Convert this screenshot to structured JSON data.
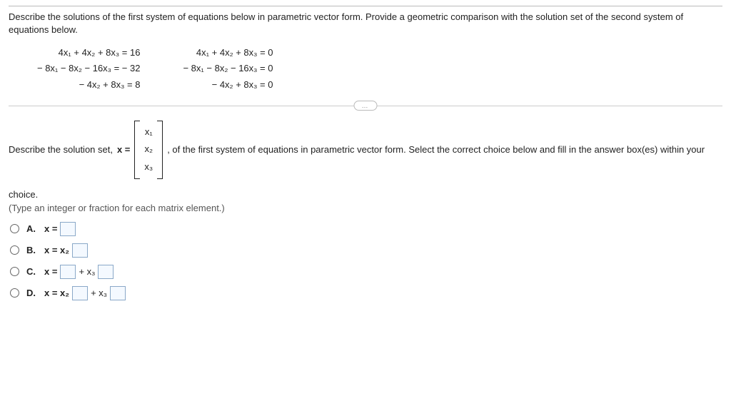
{
  "question": "Describe the solutions of the first system of equations below in parametric vector form. Provide a geometric comparison with the solution set of the second system of equations below.",
  "system1": {
    "eq1": "4x₁ + 4x₂ + 8x₃ = 16",
    "eq2": "− 8x₁ − 8x₂ − 16x₃ = − 32",
    "eq3": "− 4x₂ + 8x₃ = 8"
  },
  "system2": {
    "eq1": "4x₁ + 4x₂ + 8x₃ = 0",
    "eq2": "− 8x₁ − 8x₂ − 16x₃ = 0",
    "eq3": "− 4x₂ + 8x₃ = 0"
  },
  "divider": "…",
  "describe_pre": "Describe the solution set, ",
  "x_equals": "x = ",
  "vec": {
    "r1": "x₁",
    "r2": "x₂",
    "r3": "x₃"
  },
  "describe_post": ", of the first system of equations in parametric vector form. Select the correct choice below and fill in the answer box(es) within your",
  "choice_word": "choice.",
  "hint": "(Type an integer or fraction for each matrix element.)",
  "options": {
    "A": {
      "label": "A.",
      "expr": "x ="
    },
    "B": {
      "label": "B.",
      "expr_pre": "x = x₂"
    },
    "C": {
      "label": "C.",
      "expr_pre": "x =",
      "mid": "+ x₃"
    },
    "D": {
      "label": "D.",
      "expr_pre": "x = x₂",
      "mid": "+ x₃"
    }
  }
}
